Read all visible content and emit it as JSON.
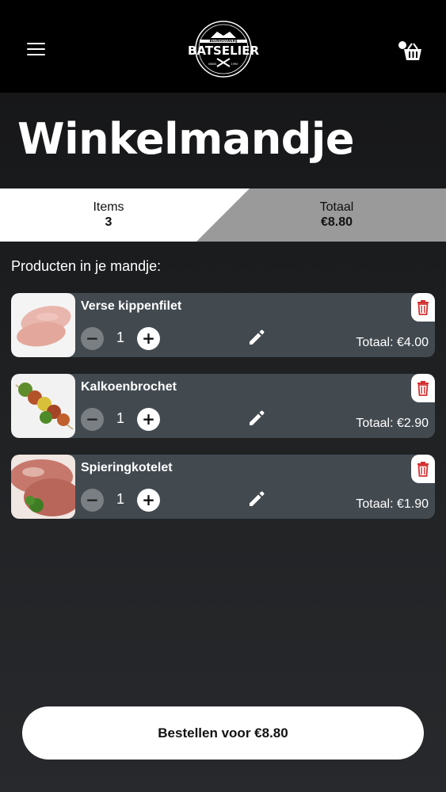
{
  "header": {
    "logo": {
      "brand": "BATSELIER",
      "tagline_top": "BEENHOUWERIJ",
      "tagline_sub": "SINDS",
      "year": "1990"
    }
  },
  "page": {
    "title": "Winkelmandje"
  },
  "summary": {
    "items_label": "Items",
    "items_value": "3",
    "total_label": "Totaal",
    "total_value": "€8.80"
  },
  "section_label": "Producten in je mandje:",
  "cart_items": [
    {
      "name": "Verse kippenfilet",
      "quantity": "1",
      "total": "Totaal: €4.00",
      "minus_label": "−",
      "plus_label": "+"
    },
    {
      "name": "Kalkoenbrochet",
      "quantity": "1",
      "total": "Totaal: €2.90",
      "minus_label": "−",
      "plus_label": "+"
    },
    {
      "name": "Spieringkotelet",
      "quantity": "1",
      "total": "Totaal: €1.90",
      "minus_label": "−",
      "plus_label": "+"
    }
  ],
  "order_button": "Bestellen voor €8.80",
  "colors": {
    "accent_delete": "#d32f2f",
    "card_bg": "#424a50",
    "header_bg": "#000000"
  },
  "icons": {
    "menu": "hamburger-icon",
    "cart": "user-basket-icon",
    "edit": "pencil-icon",
    "delete": "trash-icon"
  }
}
